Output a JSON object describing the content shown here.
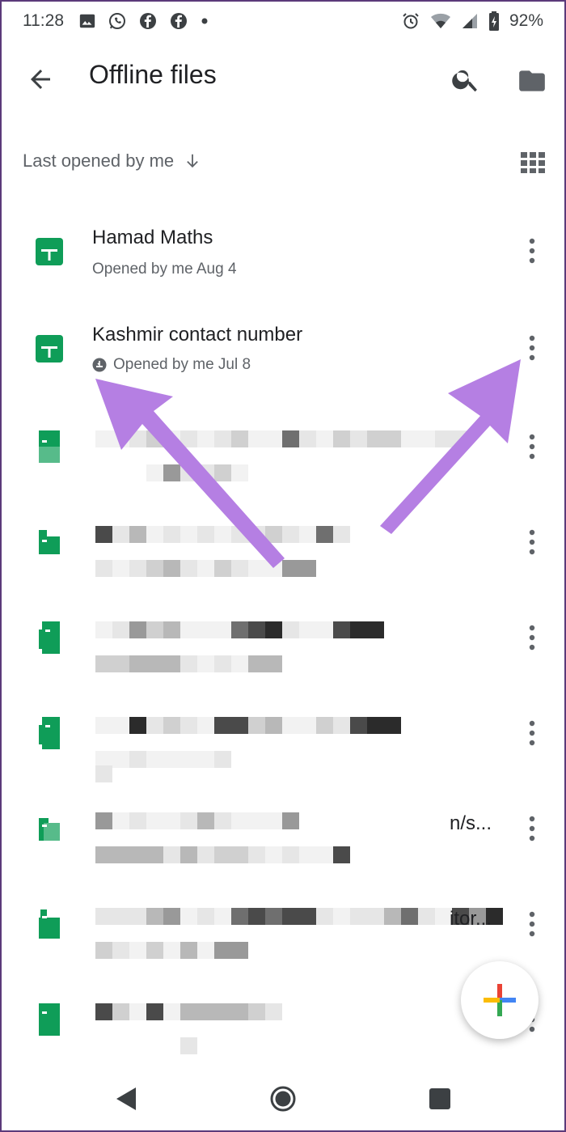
{
  "status_bar": {
    "time": "11:28",
    "battery": "92%",
    "left_icons": [
      "image-icon",
      "whatsapp-icon",
      "facebook-icon",
      "facebook-icon",
      "dot-icon"
    ],
    "right_icons": [
      "alarm-icon",
      "wifi-icon",
      "signal-icon",
      "battery-icon"
    ]
  },
  "appbar": {
    "title": "Offline files",
    "icons": [
      "back-arrow-icon",
      "search-icon",
      "folder-icon"
    ]
  },
  "sort": {
    "label": "Last opened by me",
    "direction_icon": "arrow-down-icon",
    "view_toggle_icon": "grid-view-icon"
  },
  "files": [
    {
      "name": "Hamad Maths",
      "meta": "Opened by me Aug 4",
      "icon": "sheets-icon",
      "offline_badge": false
    },
    {
      "name": "Kashmir contact number",
      "meta": "Opened by me Jul 8",
      "icon": "sheets-icon",
      "offline_badge": true
    }
  ],
  "blurred_trailing_text": [
    "n/s...",
    "itor..."
  ],
  "colors": {
    "sheets_green": "#0f9d58",
    "sheets_light": "#57bb8a",
    "annotation_arrow": "#b57fe3",
    "text_primary": "#202124",
    "text_secondary": "#5f6368"
  },
  "fab": {
    "icon": "plus-multicolor-icon"
  },
  "nav_bar": {
    "icons": [
      "nav-back-icon",
      "nav-home-icon",
      "nav-recents-icon"
    ]
  }
}
